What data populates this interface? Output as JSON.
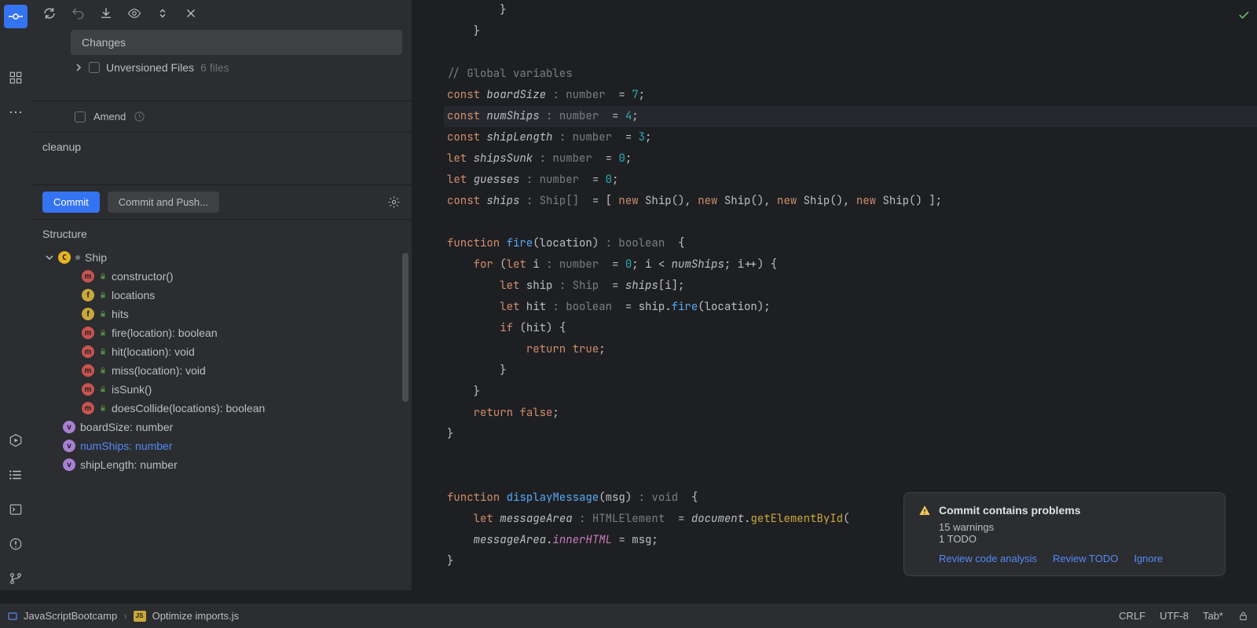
{
  "commit_panel": {
    "changes_header": "Changes",
    "unversioned_label": "Unversioned Files",
    "unversioned_count": "6 files",
    "amend_label": "Amend",
    "commit_message": "cleanup",
    "commit_btn": "Commit",
    "commit_push_btn": "Commit and Push...",
    "structure_title": "Structure",
    "structure_root": "Ship",
    "structure_items": [
      {
        "badge": "m",
        "label": "constructor()"
      },
      {
        "badge": "f",
        "label": "locations"
      },
      {
        "badge": "f",
        "label": "hits"
      },
      {
        "badge": "m",
        "label": "fire(location): boolean"
      },
      {
        "badge": "m",
        "label": "hit(location): void"
      },
      {
        "badge": "m",
        "label": "miss(location): void"
      },
      {
        "badge": "m",
        "label": "isSunk()"
      },
      {
        "badge": "m",
        "label": "doesCollide(locations): boolean"
      }
    ],
    "structure_vars": [
      {
        "label": "boardSize: number",
        "hl": false
      },
      {
        "label": "numShips: number",
        "hl": true
      },
      {
        "label": "shipLength: number",
        "hl": false
      }
    ]
  },
  "code": {
    "lines": [
      {
        "indent": 8,
        "raw": "}"
      },
      {
        "indent": 4,
        "raw": "}"
      },
      {
        "indent": 0,
        "raw": ""
      },
      {
        "indent": 0,
        "raw": "// Global variables"
      },
      {
        "indent": 0,
        "raw": "const boardSize : number  = 7;"
      },
      {
        "indent": 0,
        "raw": "const numShips : number  = 4;",
        "hl": true
      },
      {
        "indent": 0,
        "raw": "const shipLength : number  = 3;"
      },
      {
        "indent": 0,
        "raw": "let shipsSunk : number  = 0;"
      },
      {
        "indent": 0,
        "raw": "let guesses : number  = 0;"
      },
      {
        "indent": 0,
        "raw": "const ships : Ship[]  = [ new Ship(), new Ship(), new Ship(), new Ship() ];"
      },
      {
        "indent": 0,
        "raw": ""
      },
      {
        "indent": 0,
        "raw": "function fire(location) : boolean  {"
      },
      {
        "indent": 4,
        "raw": "for (let i : number  = 0; i < numShips; i++) {"
      },
      {
        "indent": 8,
        "raw": "let ship : Ship  = ships[i];"
      },
      {
        "indent": 8,
        "raw": "let hit : boolean  = ship.fire(location);"
      },
      {
        "indent": 8,
        "raw": "if (hit) {"
      },
      {
        "indent": 12,
        "raw": "return true;"
      },
      {
        "indent": 8,
        "raw": "}"
      },
      {
        "indent": 4,
        "raw": "}"
      },
      {
        "indent": 4,
        "raw": "return false;"
      },
      {
        "indent": 0,
        "raw": "}"
      },
      {
        "indent": 0,
        "raw": ""
      },
      {
        "indent": 0,
        "raw": ""
      },
      {
        "indent": 0,
        "raw": "function displayMessage(msg) : void  {"
      },
      {
        "indent": 4,
        "raw": "let messageArea : HTMLElement  = document.getElementById("
      },
      {
        "indent": 4,
        "raw": "messageArea.innerHTML = msg;"
      },
      {
        "indent": 0,
        "raw": "}"
      }
    ]
  },
  "popup": {
    "title": "Commit contains problems",
    "warnings": "15 warnings",
    "todo": "1 TODO",
    "review_code": "Review code analysis",
    "review_todo": "Review TODO",
    "ignore": "Ignore"
  },
  "statusbar": {
    "project": "JavaScriptBootcamp",
    "file": "Optimize imports.js",
    "crlf": "CRLF",
    "encoding": "UTF-8",
    "indent": "Tab*"
  }
}
